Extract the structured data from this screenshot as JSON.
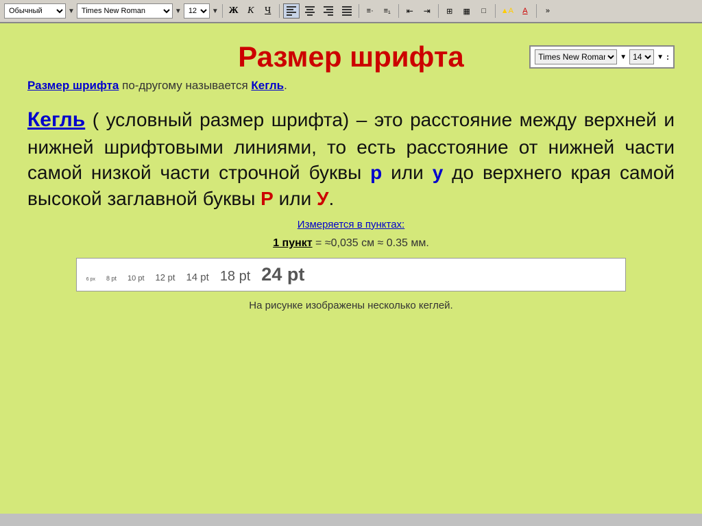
{
  "toolbar": {
    "style_label": "Обычный",
    "font_label": "Times New Roman",
    "size_label": "12",
    "bold_label": "Ж",
    "italic_label": "К",
    "underline_label": "Ч"
  },
  "font_box": {
    "font_value": "Times New Roman",
    "size_value": "14"
  },
  "page": {
    "title": "Размер шрифта",
    "subtitle_pre": "Размер шрифта",
    "subtitle_mid": " по-другому называется ",
    "subtitle_link": "Кегль",
    "subtitle_end": ".",
    "definition_term": "Кегль",
    "definition_body": " ( условный размер шрифта) – это расстояние между верхней и нижней шрифтовыми линиями, то есть расстояние от нижней части самой низкой части строчной буквы ",
    "def_p": "р",
    "def_mid": " или ",
    "def_y": "у",
    "def_cont": " до верхнего края самой высокой заглавной буквы ",
    "def_P": "Р",
    "def_or": " или ",
    "def_Y": "У",
    "def_end": ".",
    "measured_text": "Измеряется в пунктах:",
    "punkt_pre": "1 пункт",
    "punkt_post": " = ≈0,035 см ≈ 0.35 мм.",
    "sizes": [
      {
        "label": "6 px",
        "class": "sz6"
      },
      {
        "label": "8 pt",
        "class": "sz8"
      },
      {
        "label": "10 pt",
        "class": "sz10"
      },
      {
        "label": "12 pt",
        "class": "sz12"
      },
      {
        "label": "14 pt",
        "class": "sz14"
      },
      {
        "label": "18 pt",
        "class": "sz18"
      },
      {
        "label": "24 pt",
        "class": "sz24"
      }
    ],
    "caption": "На рисунке изображены несколько кеглей."
  }
}
